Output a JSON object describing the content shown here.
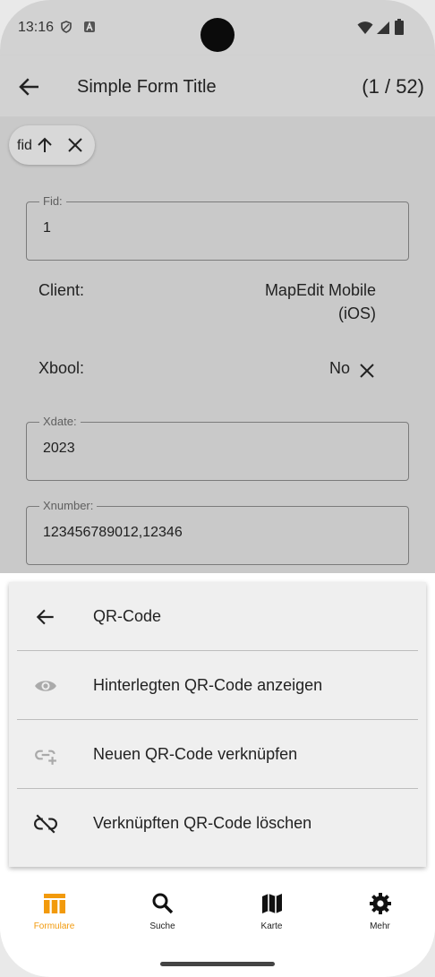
{
  "status": {
    "time": "13:16"
  },
  "appbar": {
    "title": "Simple Form Title",
    "counter": "(1 / 52)"
  },
  "chip": {
    "label": "fid"
  },
  "form": {
    "fid_label": "Fid:",
    "fid_value": "1",
    "client_label": "Client:",
    "client_value_1": "MapEdit Mobile",
    "client_value_2": "(iOS)",
    "xbool_label": "Xbool:",
    "xbool_value": "No",
    "xdate_label": "Xdate:",
    "xdate_value": "2023",
    "xnumber_label": "Xnumber:",
    "xnumber_value": "123456789012,12346"
  },
  "sheet": {
    "items": [
      {
        "label": "QR-Code",
        "icon": "arrow-left-icon"
      },
      {
        "label": "Hinterlegten QR-Code anzeigen",
        "icon": "eye-icon"
      },
      {
        "label": "Neuen QR-Code verknüpfen",
        "icon": "link-add-icon"
      },
      {
        "label": "Verknüpften QR-Code löschen",
        "icon": "link-off-icon"
      }
    ]
  },
  "nav": {
    "items": [
      {
        "label": "Formulare",
        "icon": "forms-icon",
        "active": true
      },
      {
        "label": "Suche",
        "icon": "search-icon"
      },
      {
        "label": "Karte",
        "icon": "map-icon"
      },
      {
        "label": "Mehr",
        "icon": "gear-icon"
      }
    ]
  },
  "colors": {
    "accent": "#f29a0c",
    "scrim": "#c9c9c9",
    "sheet": "#efefef"
  }
}
